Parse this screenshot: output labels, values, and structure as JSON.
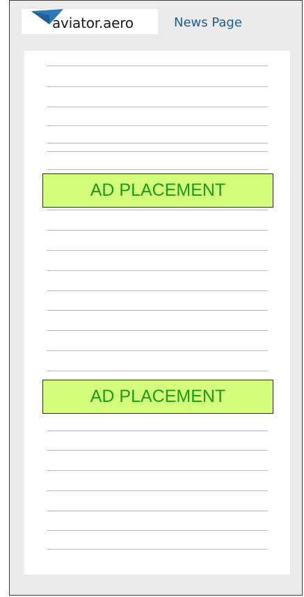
{
  "header": {
    "logo_text": "aviator.aero",
    "nav_link": "News Page"
  },
  "ads": [
    {
      "label": "AD PLACEMENT"
    },
    {
      "label": "AD PLACEMENT"
    }
  ],
  "colors": {
    "ad_background": "#d4fd7b",
    "ad_text": "#1c9a18",
    "nav_link": "#1d5d94",
    "logo_plane": "#2a7ab8",
    "page_background": "#ebebeb"
  },
  "icons": {
    "logo": "paper-plane-icon"
  }
}
